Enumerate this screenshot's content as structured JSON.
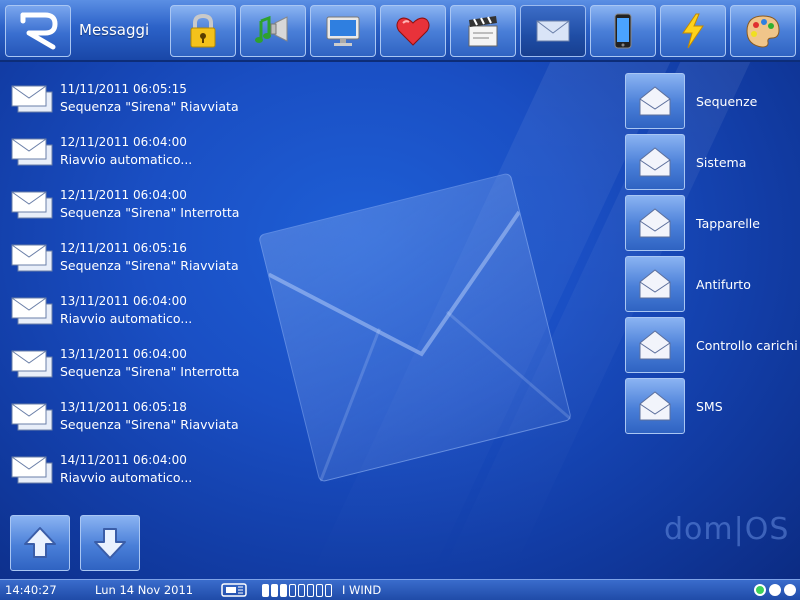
{
  "header": {
    "section_title": "Messaggi",
    "logo_icon": "r-logo-icon",
    "tabs": [
      {
        "icon": "lock-icon"
      },
      {
        "icon": "music-speaker-icon"
      },
      {
        "icon": "monitor-icon"
      },
      {
        "icon": "heart-icon"
      },
      {
        "icon": "clapperboard-icon"
      },
      {
        "icon": "envelope-icon",
        "active": true
      },
      {
        "icon": "phone-icon"
      },
      {
        "icon": "lightning-icon"
      },
      {
        "icon": "palette-icon"
      }
    ]
  },
  "messages": [
    {
      "date": "11/11/2011 06:05:15",
      "text": "Sequenza \"Sirena\" Riavviata"
    },
    {
      "date": "12/11/2011 06:04:00",
      "text": "Riavvio automatico..."
    },
    {
      "date": "12/11/2011 06:04:00",
      "text": "Sequenza \"Sirena\" Interrotta"
    },
    {
      "date": "12/11/2011 06:05:16",
      "text": "Sequenza \"Sirena\" Riavviata"
    },
    {
      "date": "13/11/2011 06:04:00",
      "text": "Riavvio automatico..."
    },
    {
      "date": "13/11/2011 06:04:00",
      "text": "Sequenza \"Sirena\" Interrotta"
    },
    {
      "date": "13/11/2011 06:05:18",
      "text": "Sequenza \"Sirena\" Riavviata"
    },
    {
      "date": "14/11/2011 06:04:00",
      "text": "Riavvio automatico..."
    }
  ],
  "categories": [
    {
      "label": "Sequenze"
    },
    {
      "label": "Sistema"
    },
    {
      "label": "Tapparelle"
    },
    {
      "label": "Antifurto"
    },
    {
      "label": "Controllo carichi"
    },
    {
      "label": "SMS"
    }
  ],
  "navigation": {
    "up_icon": "arrow-up-icon",
    "down_icon": "arrow-down-icon"
  },
  "brand": "dom|OS",
  "status": {
    "time": "14:40:27",
    "date": "Lun 14 Nov 2011",
    "signal_bars_filled": 3,
    "signal_bars_total": 8,
    "carrier": "I WIND",
    "indicators": [
      "green",
      "white",
      "white"
    ]
  },
  "colors": {
    "background": "#1a4fc4",
    "accent": "#4a7fd8",
    "indicator_green": "#3ed15b"
  }
}
